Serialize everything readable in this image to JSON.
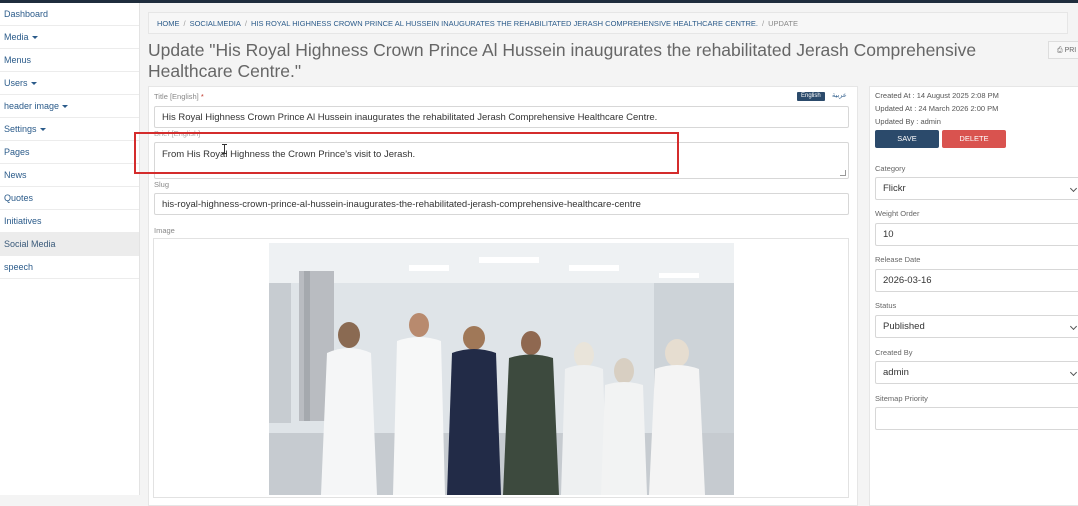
{
  "sidebar": {
    "items": [
      {
        "label": "Dashboard"
      },
      {
        "label": "Media"
      },
      {
        "label": "Menus"
      },
      {
        "label": "Users"
      },
      {
        "label": "header image"
      },
      {
        "label": "Settings"
      },
      {
        "label": "Pages"
      },
      {
        "label": "News"
      },
      {
        "label": "Quotes"
      },
      {
        "label": "Initiatives"
      },
      {
        "label": "Social Media"
      },
      {
        "label": "speech"
      }
    ]
  },
  "breadcrumb": {
    "home": "HOME",
    "section": "SOCIALMEDIA",
    "item": "HIS ROYAL HIGHNESS CROWN PRINCE AL HUSSEIN INAUGURATES THE REHABILITATED JERASH COMPREHENSIVE HEALTHCARE CENTRE.",
    "current": "UPDATE"
  },
  "page": {
    "title": "Update \"His Royal Highness Crown Prince Al Hussein inaugurates the rehabilitated Jerash Comprehensive Healthcare Centre.\"",
    "print_label": "PRI"
  },
  "form": {
    "title_label": "Title [English]",
    "required_mark": "*",
    "lang_en": "English",
    "lang_ar": "عربية",
    "title_value": "His Royal Highness Crown Prince Al Hussein inaugurates the rehabilitated Jerash Comprehensive Healthcare Centre.",
    "brief_label": "Brief [English]",
    "brief_value": "From His Royal Highness the Crown Prince's visit to Jerash.",
    "slug_label": "Slug",
    "slug_value": "his-royal-highness-crown-prince-al-hussein-inaugurates-the-rehabilitated-jerash-comprehensive-healthcare-centre",
    "image_label": "Image"
  },
  "side": {
    "created_at": "Created At : 14 August 2025 2:08 PM",
    "updated_at": "Updated At : 24 March 2026 2:00 PM",
    "updated_by": "Updated By : admin",
    "save_label": "SAVE",
    "delete_label": "DELETE",
    "category_label": "Category",
    "category_value": "Flickr",
    "weight_label": "Weight Order",
    "weight_value": "10",
    "release_label": "Release Date",
    "release_value": "2026-03-16",
    "status_label": "Status",
    "status_value": "Published",
    "created_by_label": "Created By",
    "created_by_value": "admin",
    "sitemap_label": "Sitemap Priority",
    "sitemap_value": ""
  },
  "colors": {
    "accent": "#2b4a6b",
    "danger": "#d9534f",
    "highlight": "#d42c2c"
  }
}
